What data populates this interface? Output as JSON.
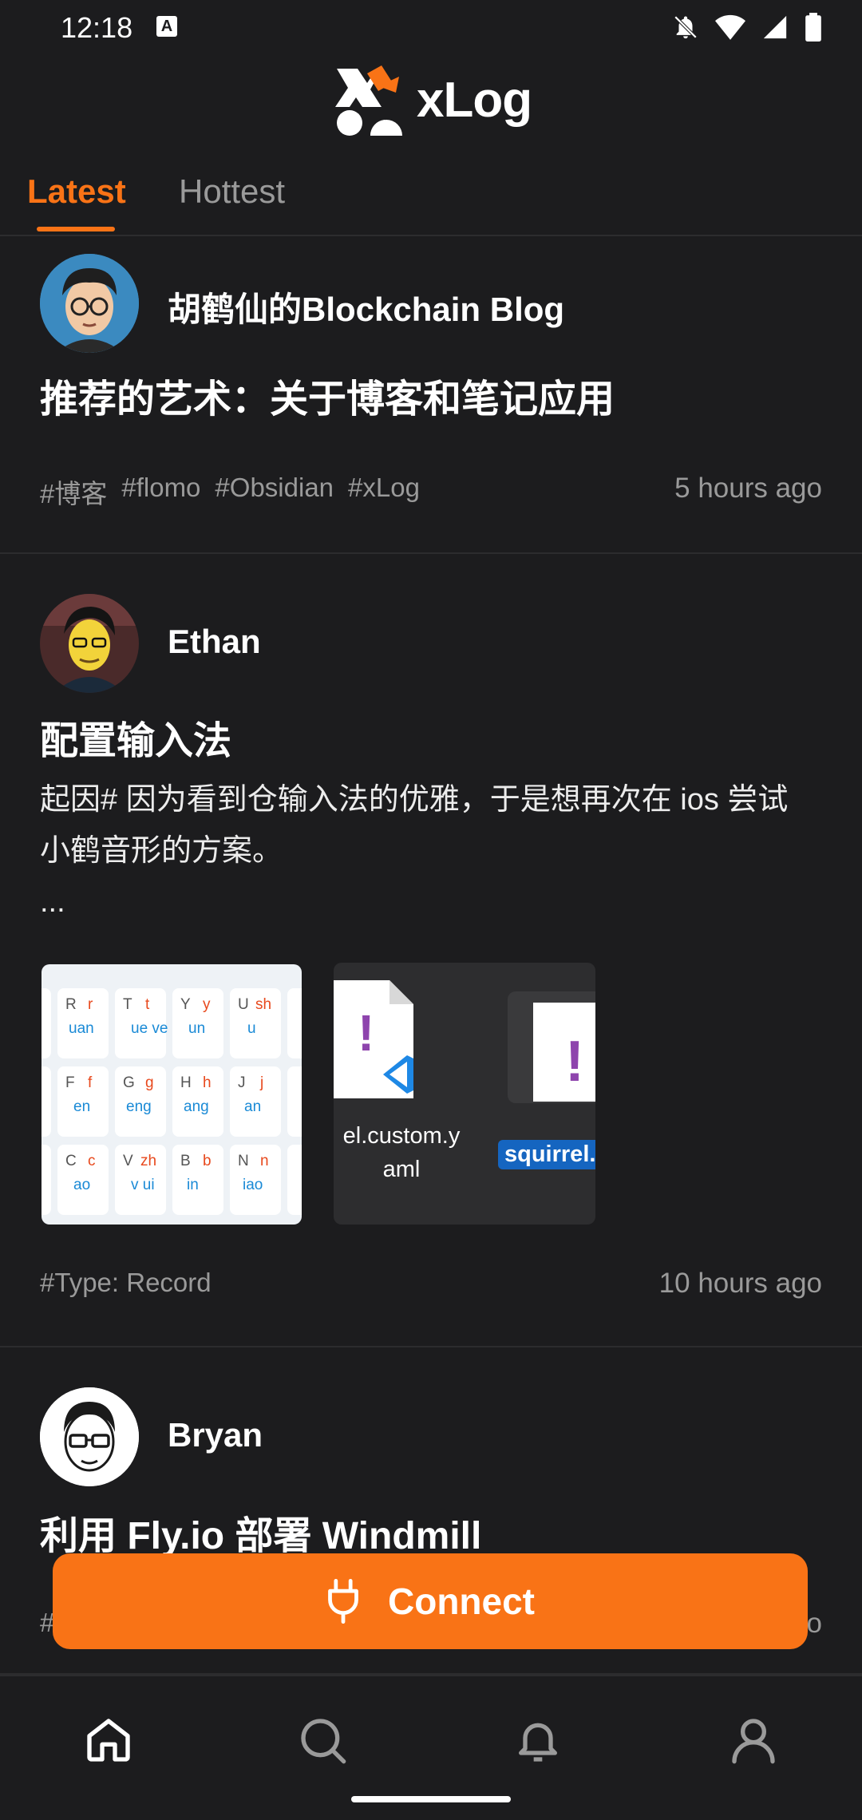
{
  "status": {
    "time": "12:18",
    "a_badge": "A"
  },
  "header": {
    "app_name": "xLog"
  },
  "tabs": [
    {
      "label": "Latest"
    },
    {
      "label": "Hottest"
    }
  ],
  "posts": [
    {
      "author": "胡鹤仙的Blockchain Blog",
      "title": "推荐的艺术：关于博客和笔记应用",
      "tags": [
        "#博客",
        "#flomo",
        "#Obsidian",
        "#xLog"
      ],
      "time": "5 hours ago"
    },
    {
      "author": "Ethan",
      "title": "配置输入法",
      "excerpt_line1": "起因# 因为看到仓输入法的优雅，于是想再次在 ios 尝试",
      "excerpt_line2": "小鹤音形的方案。",
      "excerpt_line3": "...",
      "thumb2_label": "el.custom.y",
      "thumb2_label2": "aml",
      "thumb2_badge": "squirrel.",
      "tags": [
        "#Type: Record"
      ],
      "time": "10 hours ago"
    },
    {
      "author": "Bryan",
      "title": "利用 Fly.io 部署 Windmill",
      "tag_partial": "#",
      "time_partial": "o"
    }
  ],
  "connect": {
    "label": "Connect"
  },
  "keyboard": {
    "row1": [
      [
        "R",
        "r",
        "uan"
      ],
      [
        "T",
        "t",
        "ue ve"
      ],
      [
        "Y",
        "y",
        "un"
      ],
      [
        "U",
        "sh",
        "u"
      ]
    ],
    "row2": [
      [
        "F",
        "f",
        "en"
      ],
      [
        "G",
        "g",
        "eng"
      ],
      [
        "H",
        "h",
        "ang"
      ],
      [
        "J",
        "j",
        "an"
      ]
    ],
    "row3": [
      [
        "C",
        "c",
        "ao"
      ],
      [
        "V",
        "zh",
        "v ui"
      ],
      [
        "B",
        "b",
        "in"
      ],
      [
        "N",
        "n",
        "iao"
      ]
    ]
  },
  "colors": {
    "accent": "#f97316",
    "background": "#1c1c1e",
    "muted": "#9a9a9a"
  }
}
